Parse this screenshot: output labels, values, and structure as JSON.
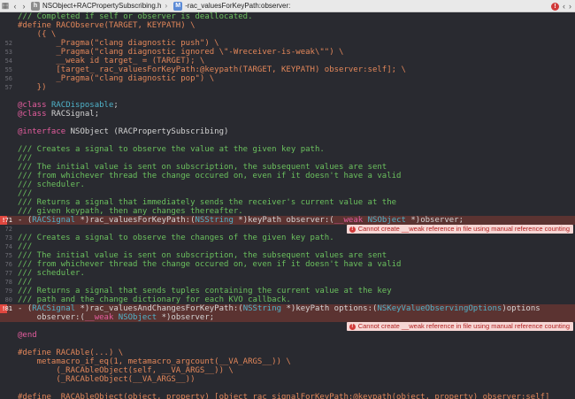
{
  "jumpbar": {
    "file_icon": "h",
    "file_name": "NSObject+RACPropertySubscribing.h",
    "separator": "›",
    "method_icon": "M",
    "method_name": "-rac_valuesForKeyPath:observer:",
    "error_count_icon": "!"
  },
  "errors": {
    "message": "Cannot create __weak reference in file using manual reference counting"
  },
  "lines": [
    {
      "n": "",
      "segs": [
        [
          "c",
          "/// Completed if self or observer is deallocated."
        ]
      ]
    },
    {
      "n": "",
      "segs": [
        [
          "p",
          "#define RACObserve(TARGET, KEYPATH) \\"
        ]
      ]
    },
    {
      "n": "",
      "segs": [
        [
          "p",
          "    ({ \\"
        ]
      ]
    },
    {
      "n": "52",
      "segs": [
        [
          "p",
          "        _Pragma(\"clang diagnostic push\") \\"
        ]
      ]
    },
    {
      "n": "53",
      "segs": [
        [
          "p",
          "        _Pragma(\"clang diagnostic ignored \\\"-Wreceiver-is-weak\\\"\") \\"
        ]
      ]
    },
    {
      "n": "54",
      "segs": [
        [
          "p",
          "        __weak id target_ = (TARGET); \\"
        ]
      ]
    },
    {
      "n": "55",
      "segs": [
        [
          "p",
          "        [target_ rac_valuesForKeyPath:@keypath(TARGET, KEYPATH) observer:self]; \\"
        ]
      ]
    },
    {
      "n": "56",
      "segs": [
        [
          "p",
          "        _Pragma(\"clang diagnostic pop\") \\"
        ]
      ]
    },
    {
      "n": "57",
      "segs": [
        [
          "p",
          "    })"
        ]
      ]
    },
    {
      "n": "",
      "segs": []
    },
    {
      "n": "",
      "segs": [
        [
          "k",
          "@class "
        ],
        [
          "t",
          "RACDisposable"
        ],
        [
          "tw",
          ";"
        ]
      ]
    },
    {
      "n": "",
      "segs": [
        [
          "k",
          "@class "
        ],
        [
          "tw",
          "RACSignal;"
        ]
      ]
    },
    {
      "n": "",
      "segs": []
    },
    {
      "n": "",
      "segs": [
        [
          "k",
          "@interface "
        ],
        [
          "tw",
          "NSObject (RACPropertySubscribing)"
        ]
      ]
    },
    {
      "n": "",
      "segs": []
    },
    {
      "n": "",
      "segs": [
        [
          "c",
          "/// Creates a signal to observe the value at the given key path."
        ]
      ]
    },
    {
      "n": "",
      "segs": [
        [
          "c",
          "///"
        ]
      ]
    },
    {
      "n": "",
      "segs": [
        [
          "c",
          "/// The initial value is sent on subscription, the subsequent values are sent"
        ]
      ]
    },
    {
      "n": "",
      "segs": [
        [
          "c",
          "/// from whichever thread the change occured on, even if it doesn't have a valid"
        ]
      ]
    },
    {
      "n": "",
      "segs": [
        [
          "c",
          "/// scheduler."
        ]
      ]
    },
    {
      "n": "",
      "segs": [
        [
          "c",
          "///"
        ]
      ]
    },
    {
      "n": "",
      "segs": [
        [
          "c",
          "/// Returns a signal that immediately sends the receiver's current value at the"
        ]
      ]
    },
    {
      "n": "",
      "segs": [
        [
          "c",
          "/// given keypath, then any changes thereafter."
        ]
      ]
    },
    {
      "n": "71",
      "err": true,
      "segs": [
        [
          "tw",
          "- ("
        ],
        [
          "t",
          "RACSignal"
        ],
        [
          "tw",
          " *)rac_valuesForKeyPath:("
        ],
        [
          "t",
          "NSString"
        ],
        [
          "tw",
          " *)keyPath observer:("
        ],
        [
          "kw",
          "__weak "
        ],
        [
          "t",
          "NSObject"
        ],
        [
          "tw",
          " *)observer;"
        ]
      ]
    },
    {
      "n": "72",
      "note": true,
      "segs": []
    },
    {
      "n": "73",
      "segs": [
        [
          "c",
          "/// Creates a signal to observe the changes of the given key path."
        ]
      ]
    },
    {
      "n": "74",
      "segs": [
        [
          "c",
          "///"
        ]
      ]
    },
    {
      "n": "75",
      "segs": [
        [
          "c",
          "/// The initial value is sent on subscription, the subsequent values are sent"
        ]
      ]
    },
    {
      "n": "76",
      "segs": [
        [
          "c",
          "/// from whichever thread the change occured on, even if it doesn't have a valid"
        ]
      ]
    },
    {
      "n": "77",
      "segs": [
        [
          "c",
          "/// scheduler."
        ]
      ]
    },
    {
      "n": "78",
      "segs": [
        [
          "c",
          "///"
        ]
      ]
    },
    {
      "n": "79",
      "segs": [
        [
          "c",
          "/// Returns a signal that sends tuples containing the current value at the key"
        ]
      ]
    },
    {
      "n": "80",
      "segs": [
        [
          "c",
          "/// path and the change dictionary for each KVO callback."
        ]
      ]
    },
    {
      "n": "81",
      "err": true,
      "segs": [
        [
          "tw",
          "- ("
        ],
        [
          "t",
          "RACSignal"
        ],
        [
          "tw",
          " *)rac_valuesAndChangesForKeyPath:("
        ],
        [
          "t",
          "NSString"
        ],
        [
          "tw",
          " *)keyPath options:("
        ],
        [
          "t",
          "NSKeyValueObservingOptions"
        ],
        [
          "tw",
          ")options"
        ]
      ]
    },
    {
      "n": "",
      "errcont": true,
      "segs": [
        [
          "tw",
          "    observer:("
        ],
        [
          "kw",
          "__weak "
        ],
        [
          "t",
          "NSObject"
        ],
        [
          "tw",
          " *)observer;"
        ]
      ]
    },
    {
      "n": "",
      "note": true,
      "segs": []
    },
    {
      "n": "",
      "segs": [
        [
          "k",
          "@end"
        ]
      ]
    },
    {
      "n": "",
      "segs": []
    },
    {
      "n": "",
      "segs": [
        [
          "p",
          "#define RACAble(...) \\"
        ]
      ]
    },
    {
      "n": "",
      "segs": [
        [
          "p",
          "    metamacro_if_eq(1, metamacro_argcount(__VA_ARGS__)) \\"
        ]
      ]
    },
    {
      "n": "",
      "segs": [
        [
          "p",
          "        (_RACAbleObject(self, __VA_ARGS__)) \\"
        ]
      ]
    },
    {
      "n": "",
      "segs": [
        [
          "p",
          "        (_RACAbleObject(__VA_ARGS__))"
        ]
      ]
    },
    {
      "n": "",
      "segs": []
    },
    {
      "n": "",
      "segs": [
        [
          "p",
          "#define _RACAbleObject(object, property) [object rac_signalForKeyPath:@keypath(object, property) observer:self]"
        ]
      ]
    }
  ]
}
